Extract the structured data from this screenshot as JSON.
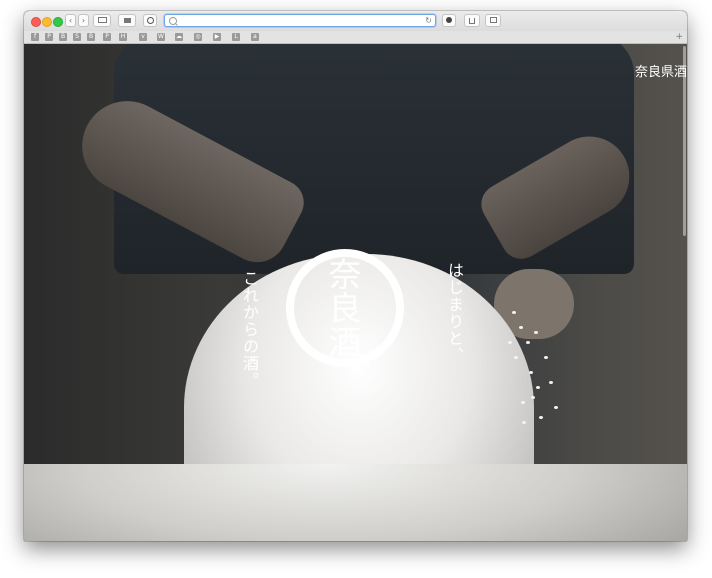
{
  "browser": {
    "back_label": "‹",
    "forward_label": "›",
    "reload_label": "↻",
    "address_value": "",
    "favorites": [
      "f",
      "P",
      "B",
      "S",
      "B",
      "P",
      "H",
      "v",
      "W",
      "☁",
      "◎",
      "▶",
      "L",
      "a"
    ],
    "add_label": "+"
  },
  "page": {
    "site_title": "奈良県酒",
    "logo": [
      "奈",
      "良",
      "酒"
    ],
    "tagline_left": "これからの酒。",
    "tagline_right": "はじまりと、"
  }
}
